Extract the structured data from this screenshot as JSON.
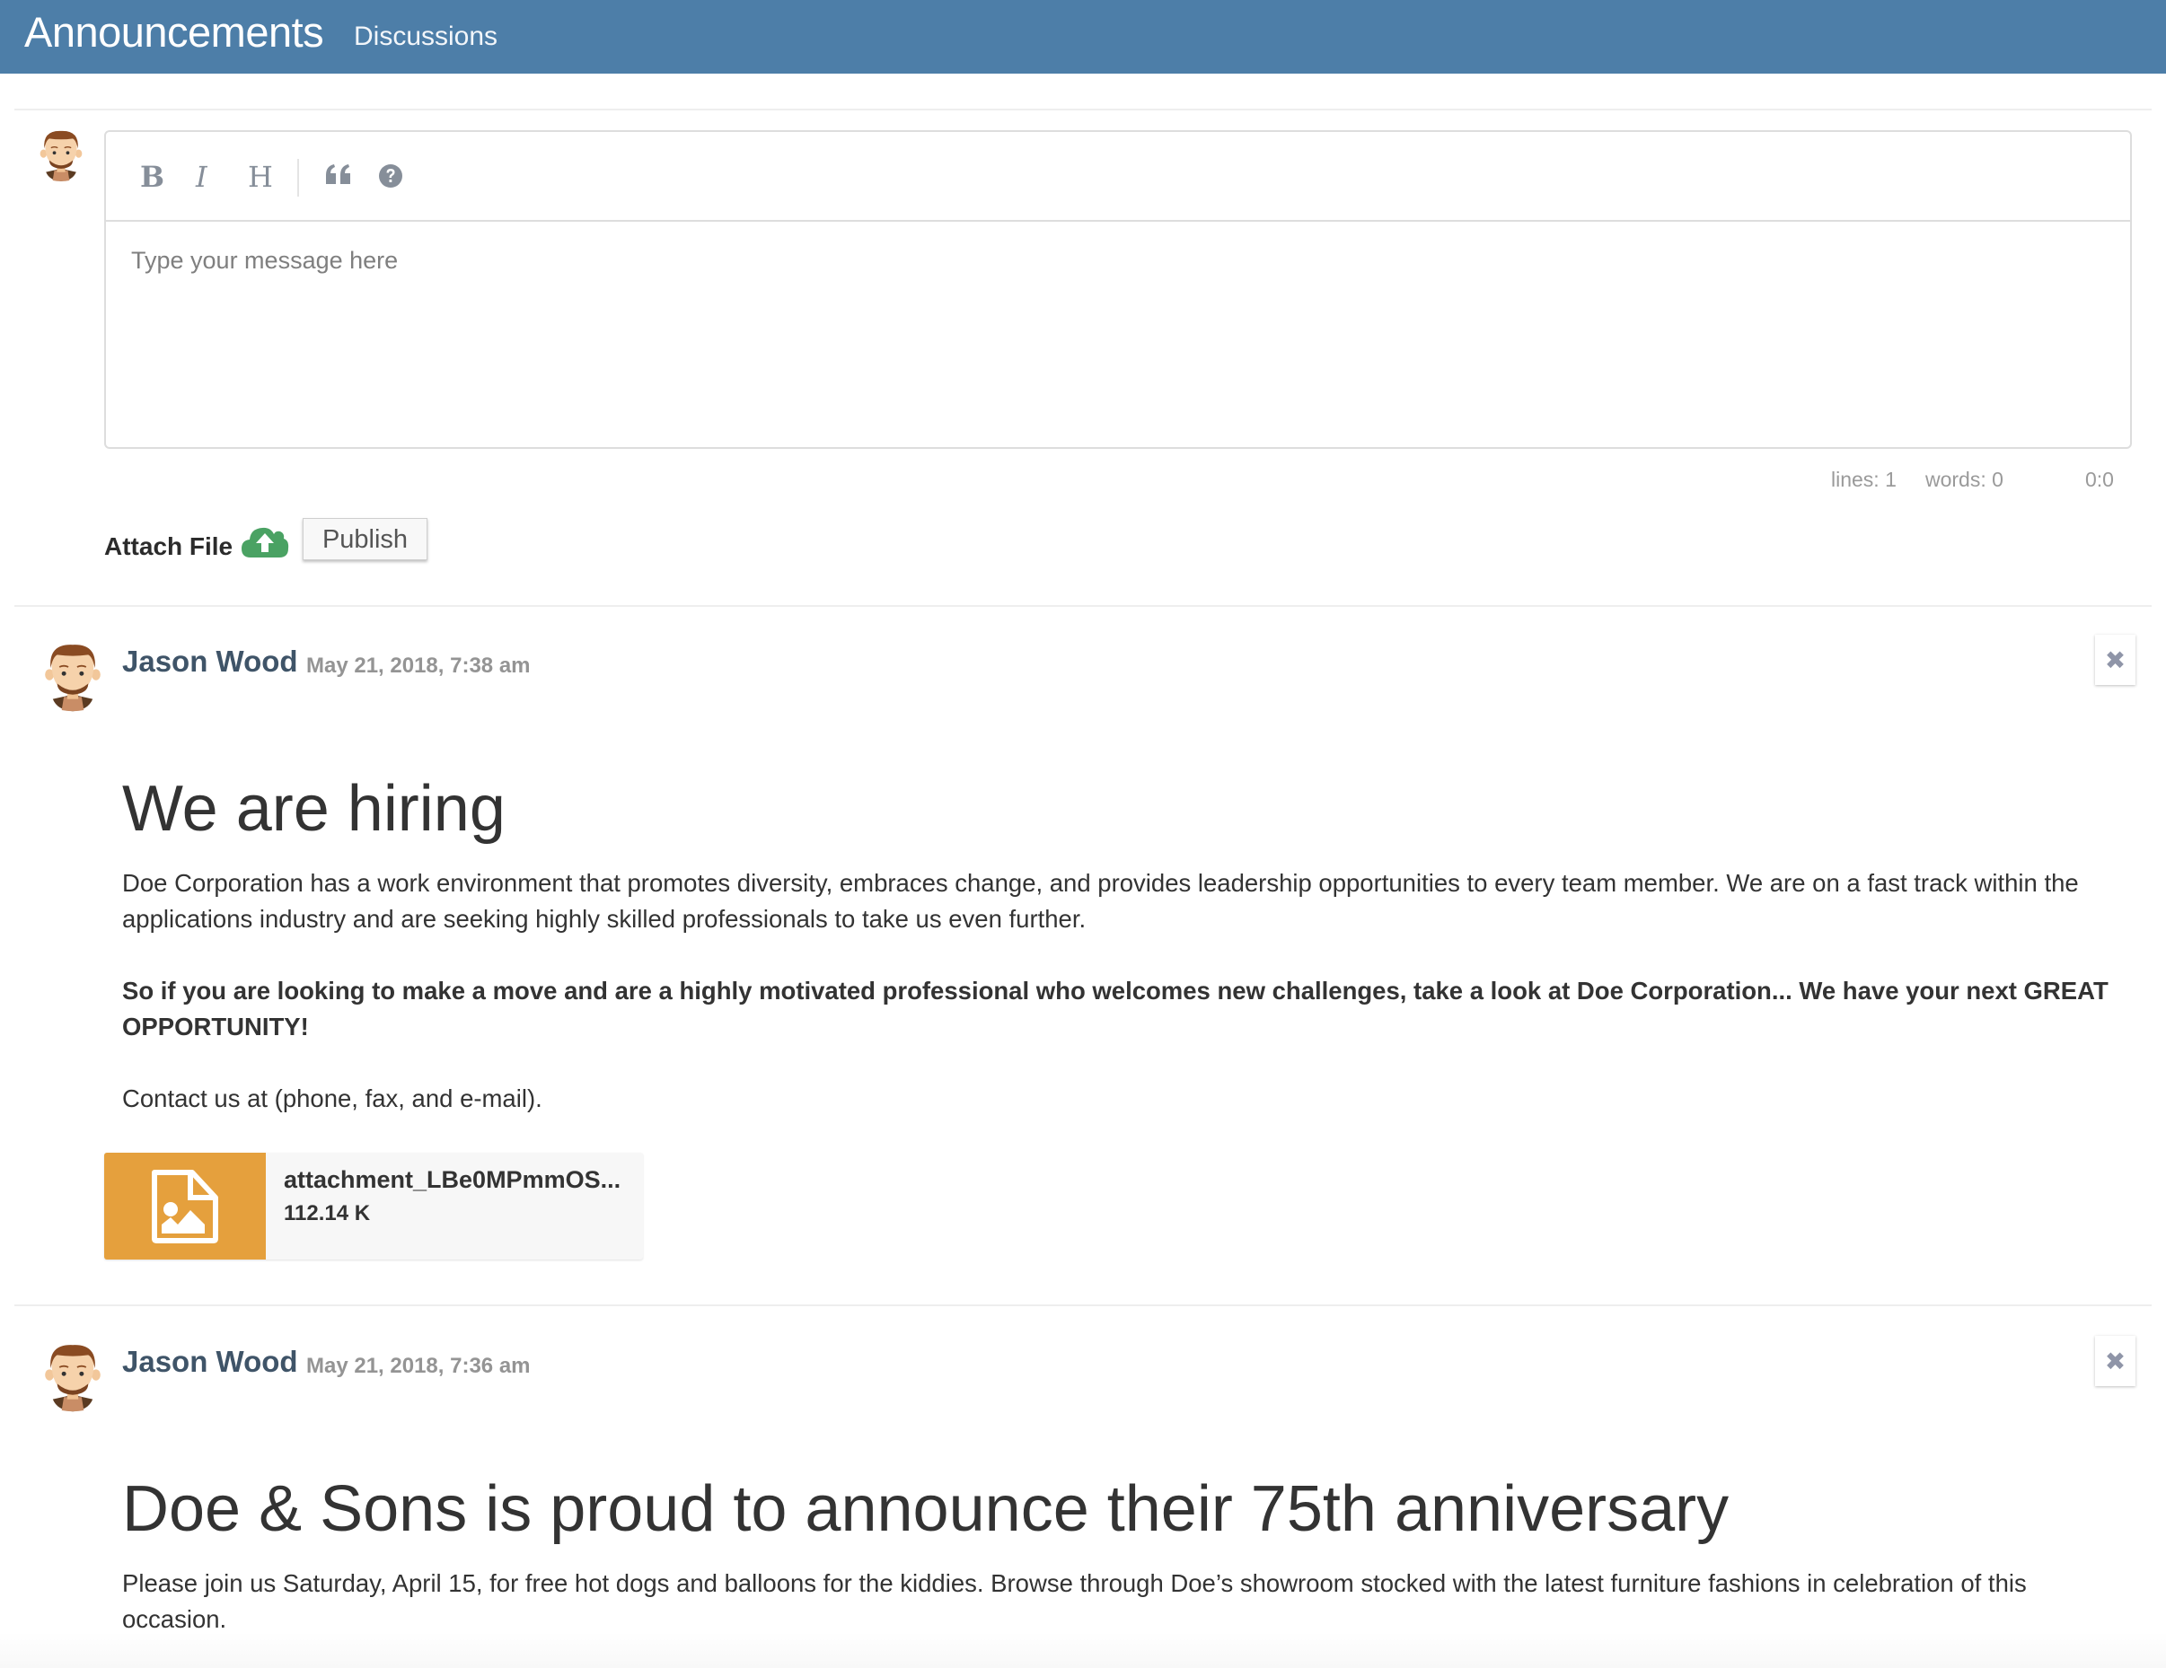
{
  "header": {
    "title": "Announcements",
    "subtitle": "Discussions",
    "color": "#4d7ea8"
  },
  "composer": {
    "toolbar": [
      {
        "icon": "bold-icon",
        "glyph": "B",
        "label": "Bold"
      },
      {
        "icon": "italic-icon",
        "glyph": "I",
        "label": "Italic"
      },
      {
        "icon": "heading-icon",
        "glyph": "H",
        "label": "Heading"
      },
      {
        "icon": "quote-icon",
        "glyph": "“",
        "label": "Quote"
      },
      {
        "icon": "help-icon",
        "glyph": "?",
        "label": "Help"
      }
    ],
    "placeholder": "Type your message here",
    "value": "",
    "status": {
      "lines": "lines: 1",
      "words": "words: 0",
      "cursor": "0:0"
    },
    "attach_label": "Attach File",
    "publish_label": "Publish"
  },
  "posts": [
    {
      "author": "Jason Wood",
      "date": "May 21, 2018, 7:38 am",
      "close_glyph": "✖",
      "title": "We are hiring",
      "paragraphs": [
        "Doe Corporation has a work environment that promotes diversity, embraces change, and provides leadership opportunities to every team member. We are on a fast track within the applications industry and are seeking highly skilled professionals to take us even further.",
        "So if you are looking to make a move and are a highly motivated professional who welcomes new challenges, take a look at Doe Corporation... We have your next GREAT OPPORTUNITY!",
        "Contact us at (phone, fax, and e-mail)."
      ],
      "attachment": {
        "name": "attachment_LBe0MPmmOS...",
        "size": "112.14 K",
        "icon": "image-file-icon",
        "color": "#e5a03d"
      }
    },
    {
      "author": "Jason Wood",
      "date": "May 21, 2018, 7:36 am",
      "close_glyph": "✖",
      "title": "Doe & Sons is proud to announce their 75th anniversary",
      "paragraphs": [
        "Please join us Saturday, April 15, for free hot dogs and balloons for the kiddies. Browse through Doe’s showroom stocked with the latest furniture fashions in celebration of this occasion."
      ]
    }
  ]
}
